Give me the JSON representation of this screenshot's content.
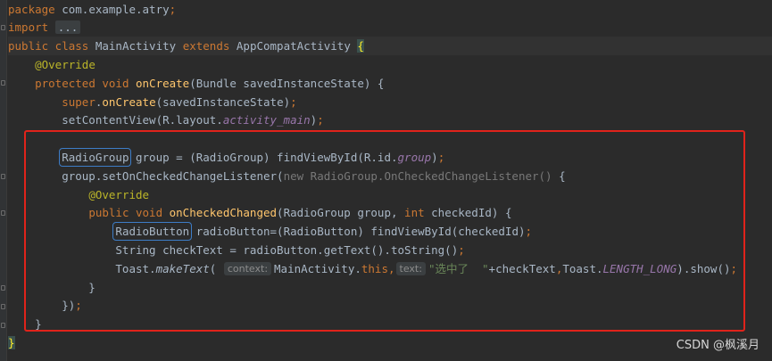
{
  "editor": {
    "lines": [
      [
        [
          "kw",
          "package "
        ],
        [
          "t",
          "com.example.atry"
        ],
        [
          "kw",
          ";"
        ]
      ],
      [
        [
          "kw",
          "import "
        ],
        [
          "fold",
          "..."
        ]
      ],
      [
        [
          "kw",
          "public class "
        ],
        [
          "t",
          "MainActivity "
        ],
        [
          "kw",
          "extends "
        ],
        [
          "t",
          "AppCompatActivity "
        ],
        [
          "bracket",
          "{"
        ]
      ],
      [
        [
          "t",
          "    "
        ],
        [
          "ann",
          "@Override"
        ]
      ],
      [
        [
          "t",
          "    "
        ],
        [
          "kw",
          "protected void "
        ],
        [
          "fn",
          "onCreate"
        ],
        [
          "t",
          "(Bundle savedInstanceState) {"
        ]
      ],
      [
        [
          "t",
          "        "
        ],
        [
          "kw",
          "super"
        ],
        [
          "t",
          "."
        ],
        [
          "fn",
          "onCreate"
        ],
        [
          "t",
          "(savedInstanceState)"
        ],
        [
          "kw",
          ";"
        ]
      ],
      [
        [
          "t",
          "        setContentView(R.layout."
        ],
        [
          "it",
          "activity_main"
        ],
        [
          "t",
          ")"
        ],
        [
          "kw",
          ";"
        ]
      ],
      [],
      [
        [
          "t",
          "        "
        ],
        [
          "boxed",
          "RadioGroup"
        ],
        [
          "t",
          " group = (RadioGroup) findViewById(R.id."
        ],
        [
          "it",
          "group"
        ],
        [
          "t",
          ")"
        ],
        [
          "kw",
          ";"
        ]
      ],
      [
        [
          "t",
          "        group.setOnCheckedChangeListener("
        ],
        [
          "gray",
          "new RadioGroup.OnCheckedChangeListener() "
        ],
        [
          "t",
          "{"
        ]
      ],
      [
        [
          "t",
          "            "
        ],
        [
          "ann",
          "@Override"
        ]
      ],
      [
        [
          "t",
          "            "
        ],
        [
          "kw",
          "public void "
        ],
        [
          "fn",
          "onCheckedChanged"
        ],
        [
          "t",
          "(RadioGroup group, "
        ],
        [
          "kw",
          "int "
        ],
        [
          "t",
          "checkedId) {"
        ]
      ],
      [
        [
          "t",
          "                "
        ],
        [
          "boxed",
          "RadioButton"
        ],
        [
          "t",
          " radioButton=(RadioButton) findViewById(checkedId)"
        ],
        [
          "kw",
          ";"
        ]
      ],
      [
        [
          "t",
          "                String checkText = radioButton.getText().toString()"
        ],
        [
          "kw",
          ";"
        ]
      ],
      [
        [
          "t",
          "                Toast."
        ],
        [
          "itp",
          "makeText"
        ],
        [
          "t",
          "( "
        ],
        [
          "hint",
          "context:"
        ],
        [
          "t",
          "MainActivity."
        ],
        [
          "kw",
          "this"
        ],
        [
          "kw",
          ","
        ],
        [
          "hint",
          "text:"
        ],
        [
          "str",
          "\"选中了  \""
        ],
        [
          "t",
          "+checkText"
        ],
        [
          "kw",
          ","
        ],
        [
          "t",
          "Toast."
        ],
        [
          "it",
          "LENGTH_LONG"
        ],
        [
          "t",
          ").show()"
        ],
        [
          "kw",
          ";"
        ]
      ],
      [
        [
          "t",
          "            }"
        ]
      ],
      [
        [
          "t",
          "        })"
        ],
        [
          "kw",
          ";"
        ]
      ],
      [
        [
          "t",
          "    }"
        ]
      ],
      [
        [
          "bracket",
          "}"
        ]
      ]
    ]
  },
  "watermark": "CSDN @枫溪月"
}
